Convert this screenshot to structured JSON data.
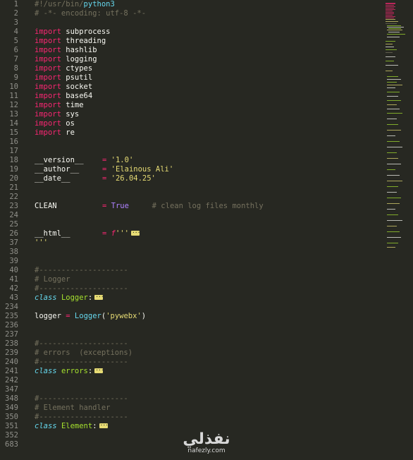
{
  "gutter": {
    "line_numbers": [
      "1",
      "2",
      "3",
      "4",
      "5",
      "6",
      "7",
      "8",
      "9",
      "10",
      "11",
      "12",
      "13",
      "14",
      "15",
      "16",
      "17",
      "18",
      "19",
      "20",
      "21",
      "22",
      "23",
      "24",
      "25",
      "26",
      "37",
      "38",
      "39",
      "40",
      "41",
      "42",
      "43",
      "234",
      "235",
      "236",
      "237",
      "238",
      "239",
      "240",
      "241",
      "242",
      "347",
      "348",
      "349",
      "350",
      "351",
      "352",
      "683"
    ]
  },
  "code": {
    "shebang_prefix": "#!/usr/bin/",
    "shebang_interp": "python3",
    "encoding_comment": "# -*- encoding: utf-8 -*-",
    "import_kw": "import",
    "imports": [
      "subprocess",
      "threading",
      "hashlib",
      "logging",
      "ctypes",
      "psutil",
      "socket",
      "base64",
      "time",
      "sys",
      "os",
      "re"
    ],
    "version": {
      "name": "__version__",
      "value": "'1.0'"
    },
    "author": {
      "name": "__author__",
      "value": "'Elainous Ali'"
    },
    "date": {
      "name": "__date__",
      "value": "'26.04.25'"
    },
    "clean": {
      "name": "CLEAN",
      "value": "True",
      "comment": "# clean log files monthly"
    },
    "html": {
      "name": "__html__",
      "prefix": "f",
      "quote": "'''",
      "closing": "'''"
    },
    "assign_op": "=",
    "separator_comment": "#--------------------",
    "class_kw": "class",
    "sections": [
      {
        "comment": "# Logger",
        "class_name": "Logger"
      },
      {
        "comment": "# errors  (exceptions)",
        "class_name": "errors"
      },
      {
        "comment": "# Element handler",
        "class_name": "Element"
      }
    ],
    "logger_stmt": {
      "var": "logger",
      "call": "Logger",
      "arg": "'pywebx'"
    }
  },
  "watermark": {
    "arabic": "نفذلي",
    "latin": "nafezly.com"
  },
  "colors": {
    "background": "#272822",
    "keyword": "#f92672",
    "string": "#e6db74",
    "comment": "#75715e",
    "class_name": "#a6e22e",
    "builtin": "#66d9ef",
    "constant": "#ae81ff"
  }
}
